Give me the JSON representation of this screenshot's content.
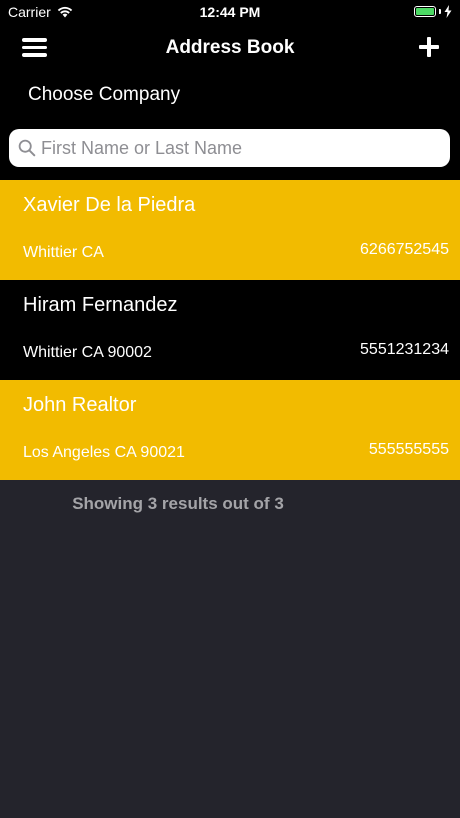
{
  "status_bar": {
    "carrier": "Carrier",
    "time": "12:44 PM",
    "battery_color": "#4cd964"
  },
  "nav": {
    "title": "Address Book",
    "menu_icon": "hamburger-menu-icon",
    "add_icon": "plus-icon"
  },
  "company": {
    "label": "Choose Company"
  },
  "search": {
    "placeholder": "First Name or Last Name",
    "value": "",
    "icon": "search-icon"
  },
  "contacts": [
    {
      "name": "Xavier De la Piedra",
      "address": "Whittier CA",
      "phone": "6266752545",
      "row_color": "#f2bb00"
    },
    {
      "name": "Hiram Fernandez",
      "address": "Whittier CA 90002",
      "phone": "5551231234",
      "row_color": "#000000"
    },
    {
      "name": "John Realtor",
      "address": "Los Angeles CA 90021",
      "phone": "555555555",
      "row_color": "#f2bb00"
    }
  ],
  "results": {
    "text": "Showing 3 results out of 3"
  },
  "colors": {
    "accent_yellow": "#f2bb00",
    "background": "#24242c",
    "bar_black": "#000000",
    "muted_text": "#a4a4a8"
  }
}
